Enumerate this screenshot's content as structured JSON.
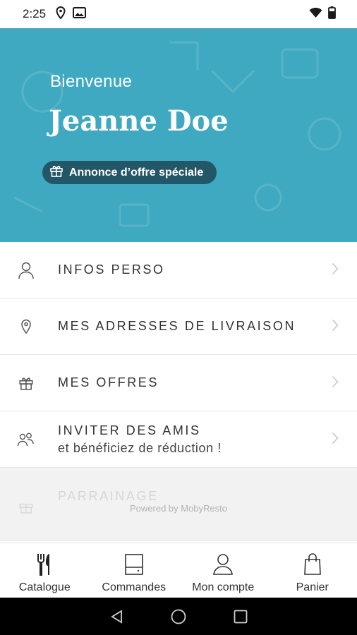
{
  "status_bar": {
    "time": "2:25",
    "icons_left": [
      "location-icon",
      "photo-icon"
    ],
    "icons_right": [
      "wifi-icon",
      "battery-icon"
    ]
  },
  "hero": {
    "background_color": "#3fa9c1",
    "welcome": "Bienvenue",
    "user_name": "Jeanne Doe",
    "offer_pill": {
      "label": "Annonce d’offre spéciale",
      "icon": "gift-icon",
      "color": "#235767"
    }
  },
  "menu": {
    "items": [
      {
        "label": "INFOS PERSO",
        "icon": "user-icon"
      },
      {
        "label": "MES ADRESSES DE LIVRAISON",
        "icon": "location-pin-icon"
      },
      {
        "label": "MES OFFRES",
        "icon": "gift-icon"
      },
      {
        "label": "INVITER DES AMIS",
        "sublabel": "et bénéficiez de réduction !",
        "icon": "users-icon"
      },
      {
        "label": "PARRAINAGE",
        "icon": "gift-icon"
      }
    ],
    "powered_by": "Powered by MobyResto"
  },
  "tabs": [
    {
      "label": "Catalogue",
      "icon": "cutlery-icon"
    },
    {
      "label": "Commandes",
      "icon": "receipt-icon"
    },
    {
      "label": "Mon compte",
      "icon": "account-icon"
    },
    {
      "label": "Panier",
      "icon": "bag-icon"
    }
  ],
  "nav_bar": {
    "buttons": [
      "back-icon",
      "home-icon",
      "recents-icon"
    ]
  }
}
